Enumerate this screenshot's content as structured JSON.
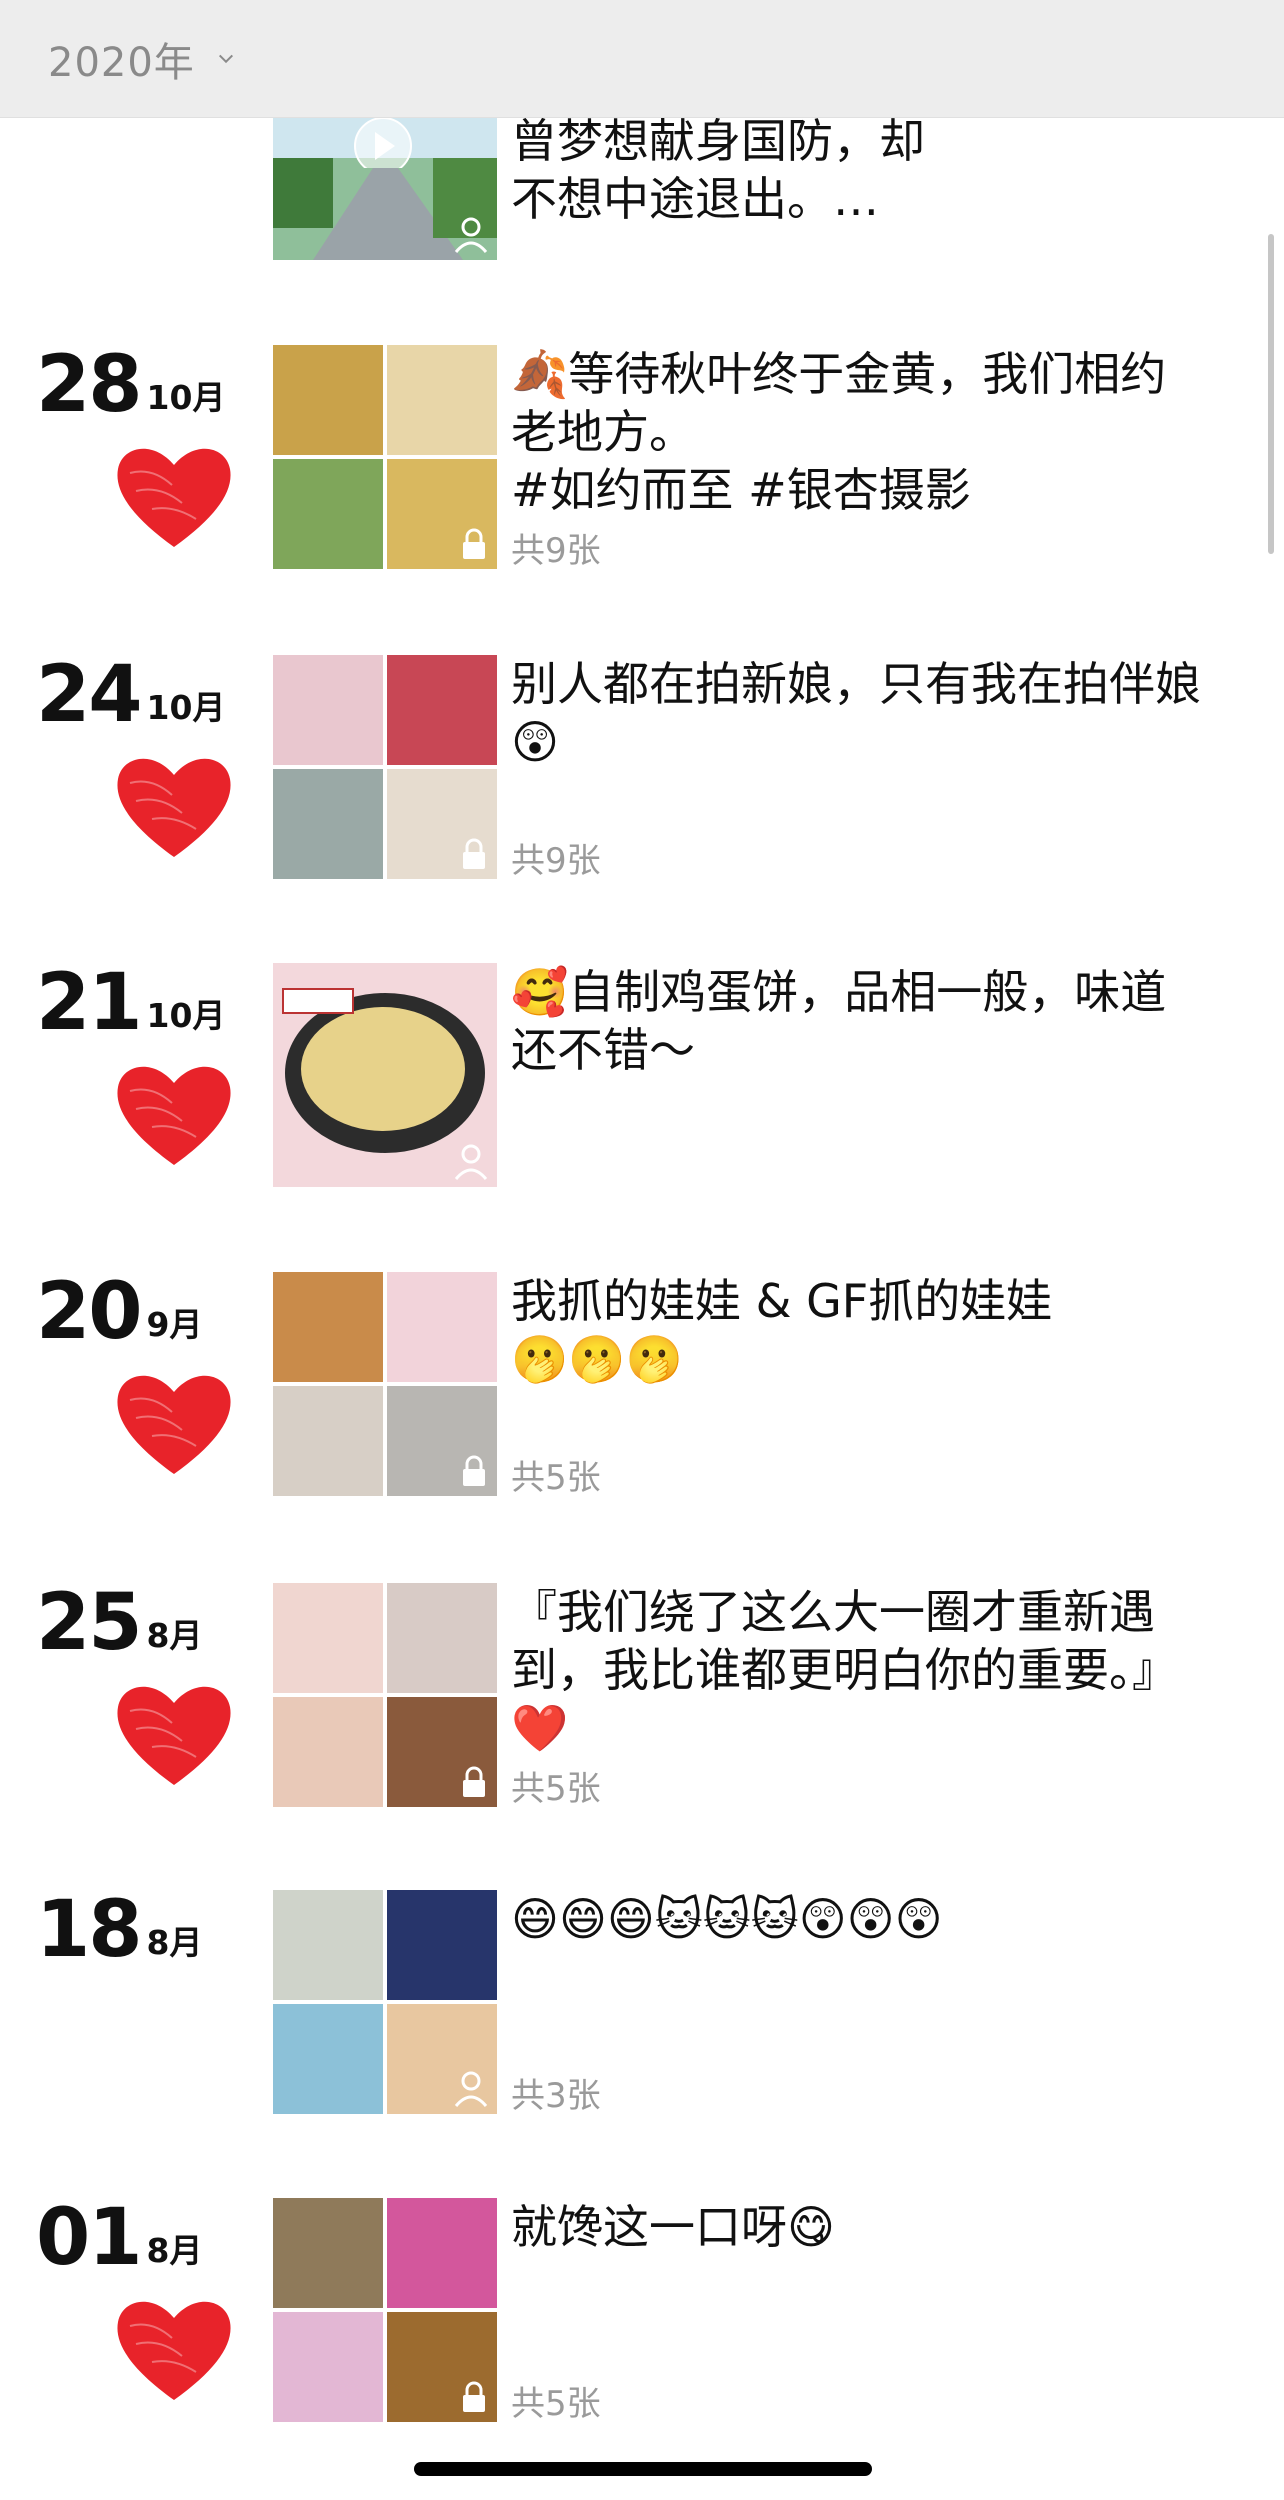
{
  "header": {
    "year": "2020年"
  },
  "partial_post": {
    "text": "曾梦想献身国防，却\n不想中途退出。…"
  },
  "posts": [
    {
      "day": "28",
      "month": "10月",
      "text": "🍂等待秋叶终于金黄，我们相约\n老地方。\n#如约而至 #银杏摄影",
      "count": "共9张",
      "liked": true
    },
    {
      "day": "24",
      "month": "10月",
      "text": "别人都在拍新娘，只有我在拍伴娘\n😲",
      "count": "共9张",
      "liked": true
    },
    {
      "day": "21",
      "month": "10月",
      "text": "🥰自制鸡蛋饼，品相一般，味道\n还不错～",
      "count": "",
      "liked": true
    },
    {
      "day": "20",
      "month": "9月",
      "text": "我抓的娃娃 & GF抓的娃娃\n🫢🫢🫢",
      "count": "共5张",
      "liked": true
    },
    {
      "day": "25",
      "month": "8月",
      "text": "『我们绕了这么大一圈才重新遇\n到，我比谁都更明白你的重要。』\n❤️",
      "count": "共5张",
      "liked": true
    },
    {
      "day": "18",
      "month": "8月",
      "text": "😄😄😄🐱🐱🐱😲😲😲",
      "count": "共3张",
      "liked": false
    },
    {
      "day": "01",
      "month": "8月",
      "text": "就馋这一口呀😋",
      "count": "共5张",
      "liked": true
    }
  ],
  "colors": {
    "heart": "#e8232a",
    "header_bg": "#ededed",
    "muted_text": "#9a9a9a"
  },
  "icons": [
    "chevron-down-icon",
    "heart-icon",
    "lock-icon",
    "person-icon",
    "play-icon"
  ]
}
